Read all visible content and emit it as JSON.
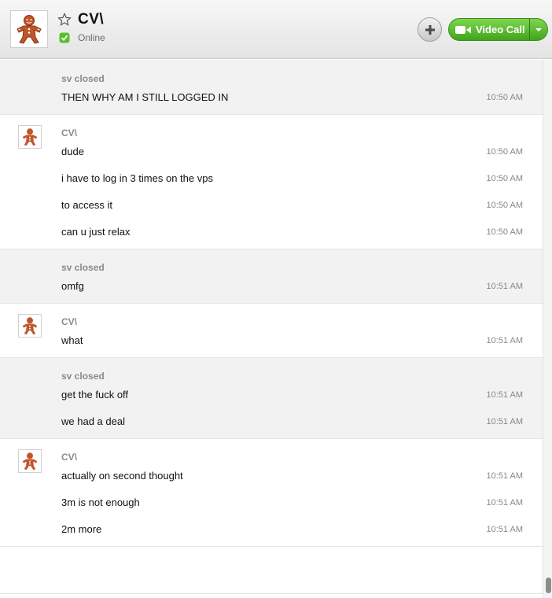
{
  "header": {
    "contact_name": "CV\\",
    "status": "Online",
    "video_call_label": "Video Call",
    "icons": {
      "avatar": "gingerbread-avatar-icon",
      "favorite": "star-icon",
      "status": "online-status-icon",
      "add": "plus-icon",
      "video": "video-camera-icon",
      "dropdown": "chevron-down-icon"
    },
    "colors": {
      "accent": "#4cb627",
      "status": "#5bbf2c"
    }
  },
  "conversation": {
    "groups": [
      {
        "sender": "sv closed",
        "is_self": true,
        "messages": [
          {
            "text": "THEN WHY AM I STILL LOGGED IN",
            "time": "10:50 AM"
          }
        ]
      },
      {
        "sender": "CV\\",
        "is_self": false,
        "messages": [
          {
            "text": "dude",
            "time": "10:50 AM"
          },
          {
            "text": "i have to log in 3 times on the vps",
            "time": "10:50 AM"
          },
          {
            "text": "to access it",
            "time": "10:50 AM"
          },
          {
            "text": "can u just relax",
            "time": "10:50 AM"
          }
        ]
      },
      {
        "sender": "sv closed",
        "is_self": true,
        "messages": [
          {
            "text": "omfg",
            "time": "10:51 AM"
          }
        ]
      },
      {
        "sender": "CV\\",
        "is_self": false,
        "messages": [
          {
            "text": "what",
            "time": "10:51 AM"
          }
        ]
      },
      {
        "sender": "sv closed",
        "is_self": true,
        "messages": [
          {
            "text": "get the fuck off",
            "time": "10:51 AM"
          },
          {
            "text": "we had a deal",
            "time": "10:51 AM"
          }
        ]
      },
      {
        "sender": "CV\\",
        "is_self": false,
        "messages": [
          {
            "text": "actually on second thought",
            "time": "10:51 AM"
          },
          {
            "text": "3m is not enough",
            "time": "10:51 AM"
          },
          {
            "text": "2m more",
            "time": "10:51 AM"
          }
        ]
      }
    ]
  }
}
